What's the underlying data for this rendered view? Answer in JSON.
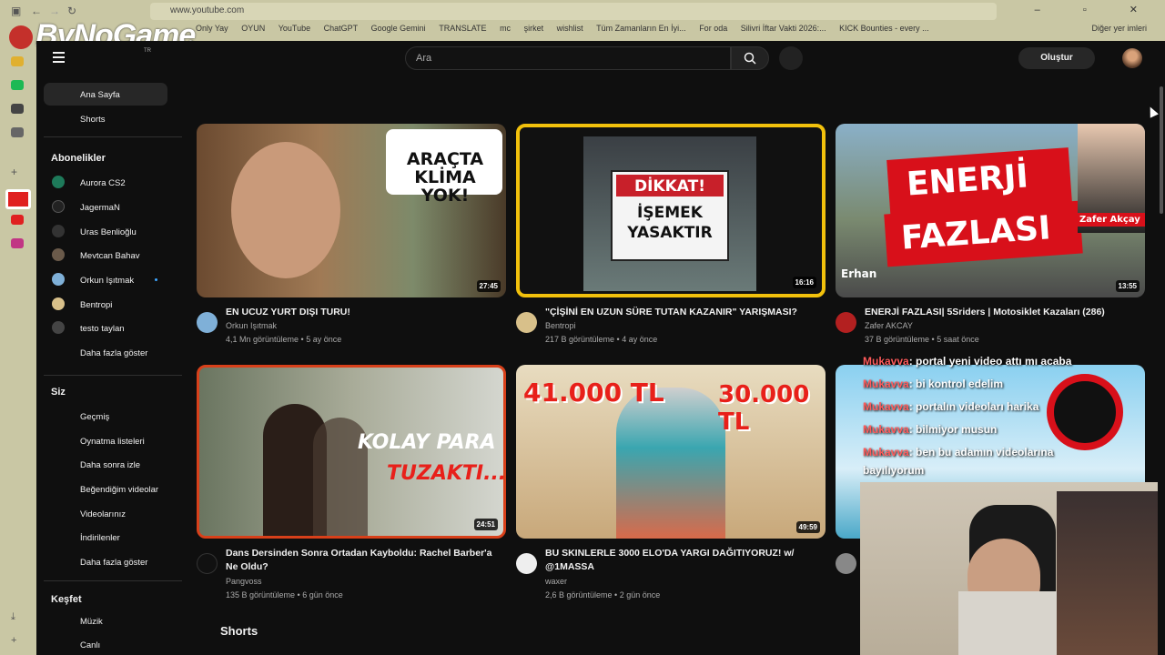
{
  "browser": {
    "url": "www.youtube.com",
    "bookmarks": [
      "Only Yay",
      "OYUN",
      "YouTube",
      "ChatGPT",
      "Google Gemini",
      "TRANSLATE",
      "mc",
      "şirket",
      "wishlist",
      "Tüm Zamanların En İyi...",
      "For oda",
      "Silivri İftar Vakti 2026:...",
      "KICK Bounties - every ..."
    ],
    "bookmarks_other": "Diğer yer imleri",
    "overlay_logo": "ByNoGame"
  },
  "header": {
    "country_code": "TR",
    "search_placeholder": "Ara",
    "create_label": "Oluştur"
  },
  "sidebar": {
    "top": [
      "Ana Sayfa",
      "Shorts"
    ],
    "subscriptions_title": "Abonelikler",
    "subscriptions": [
      {
        "name": "Aurora CS2",
        "color": "#1e7a5a"
      },
      {
        "name": "JagermaN",
        "color": "#222222"
      },
      {
        "name": "Uras Benlioğlu",
        "color": "#333333"
      },
      {
        "name": "Mevtcan Bahav",
        "color": "#6a5a4a"
      },
      {
        "name": "Orkun Işıtmak",
        "color": "#7fb0d8"
      },
      {
        "name": "Bentropi",
        "color": "#d8c08a"
      },
      {
        "name": "testo taylan",
        "color": "#444444"
      }
    ],
    "show_more": "Daha fazla göster",
    "you_title": "Siz",
    "you_items": [
      "Geçmiş",
      "Oynatma listeleri",
      "Daha sonra izle",
      "Beğendiğim videolar",
      "Videolarınız",
      "İndirilenler",
      "Daha fazla göster"
    ],
    "explore_title": "Keşfet",
    "explore_items": [
      "Müzik",
      "Canlı"
    ]
  },
  "videos": [
    {
      "title": "EN UCUZ YURT DIŞI TURU!",
      "channel": "Orkun Işıtmak",
      "meta": "4,1 Mn görüntüleme • 5 ay önce",
      "duration": "27:45",
      "overlay1": "ARAÇTA",
      "overlay2": "KLİMA YOK!"
    },
    {
      "title": "\"ÇİŞİNİ EN UZUN SÜRE TUTAN KAZANIR\" YARIŞMASI?",
      "channel": "Bentropi",
      "meta": "217 B görüntüleme • 4 ay önce",
      "duration": "16:16",
      "overlay1": "DİKKAT!",
      "overlay2": "İŞEMEK",
      "overlay3": "YASAKTIR"
    },
    {
      "title": "ENERJİ FAZLASI| 5Sriders | Motosiklet Kazaları (286)",
      "channel": "Zafer AKCAY",
      "meta": "37 B görüntüleme • 5 saat önce",
      "duration": "13:55",
      "overlay1": "ENERJİ",
      "overlay2": "FAZLASI",
      "overlay3": "Zafer Akçay",
      "overlay4": "Erhan"
    },
    {
      "title": "Dans Dersinden Sonra Ortadan Kayboldu: Rachel Barber'a Ne Oldu?",
      "channel": "Pangvoss",
      "meta": "135 B görüntüleme • 6 gün önce",
      "duration": "24:51",
      "overlay1": "KOLAY PARA",
      "overlay2": "TUZAKTI..."
    },
    {
      "title": "BU SKINLERLE 3000 ELO'DA YARGI DAĞITIYORUZ! w/ @1MASSA",
      "channel": "waxer",
      "meta": "2,6 B görüntüleme • 2 gün önce",
      "duration": "49:59",
      "overlay1": "41.000 TL",
      "overlay2": "30.000 TL"
    }
  ],
  "chat": [
    {
      "user": "Mukavva",
      "msg": ": portal yeni video attı mı acaba"
    },
    {
      "user": "Mukavva",
      "msg": ": bi kontrol edelim"
    },
    {
      "user": "Mukavva",
      "msg": ": portalın videoları harika"
    },
    {
      "user": "Mukavva",
      "msg": ": bilmiyor musun"
    },
    {
      "user": "Mukavva",
      "msg": ": ben bu adamın videolarına"
    }
  ],
  "chat_wrap": "bayılıyorum",
  "shorts_title": "Shorts"
}
